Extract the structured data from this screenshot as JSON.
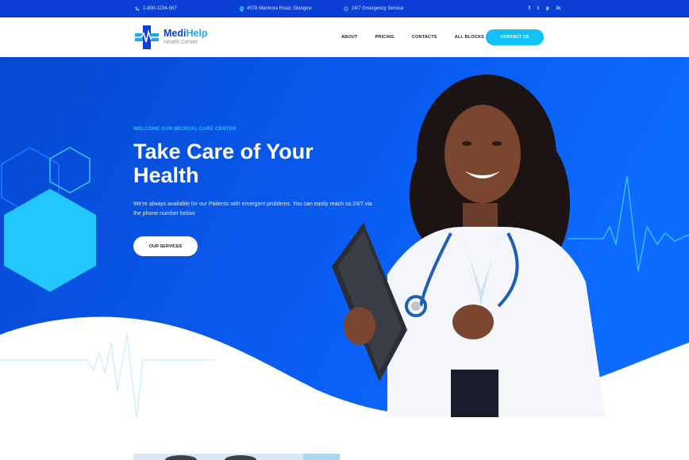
{
  "topbar": {
    "phone": "1-800-1234-567",
    "address": "4578 Marmora Road, Glasgow",
    "service": "24/7 Emergency Service",
    "social": [
      {
        "icon": "facebook-icon",
        "glyph": "f"
      },
      {
        "icon": "twitter-icon",
        "glyph": "t"
      },
      {
        "icon": "pinterest-icon",
        "glyph": "p"
      },
      {
        "icon": "linkedin-icon",
        "glyph": "in"
      }
    ]
  },
  "header": {
    "brand_part1": "Medi",
    "brand_part2": "Help",
    "brand_sub": "Health Center",
    "nav": [
      "ABOUT",
      "PRICING",
      "CONTACTS",
      "ALL BLOCKS"
    ],
    "cta": "CONTACT US"
  },
  "hero": {
    "eyebrow": "WELCOME OUR MEDICAL CARE CENTER",
    "title": "Take Care of Your Health",
    "description": "We're always available for our Patients with emergent problems. You can easily reach us 24/7 via the phone number below:",
    "button": "OUR SERVICES"
  },
  "colors": {
    "primary": "#0b3fd6",
    "hero_blue": "#0a5cf2",
    "accent": "#12c0f5",
    "text_dark": "#1a1f33"
  }
}
